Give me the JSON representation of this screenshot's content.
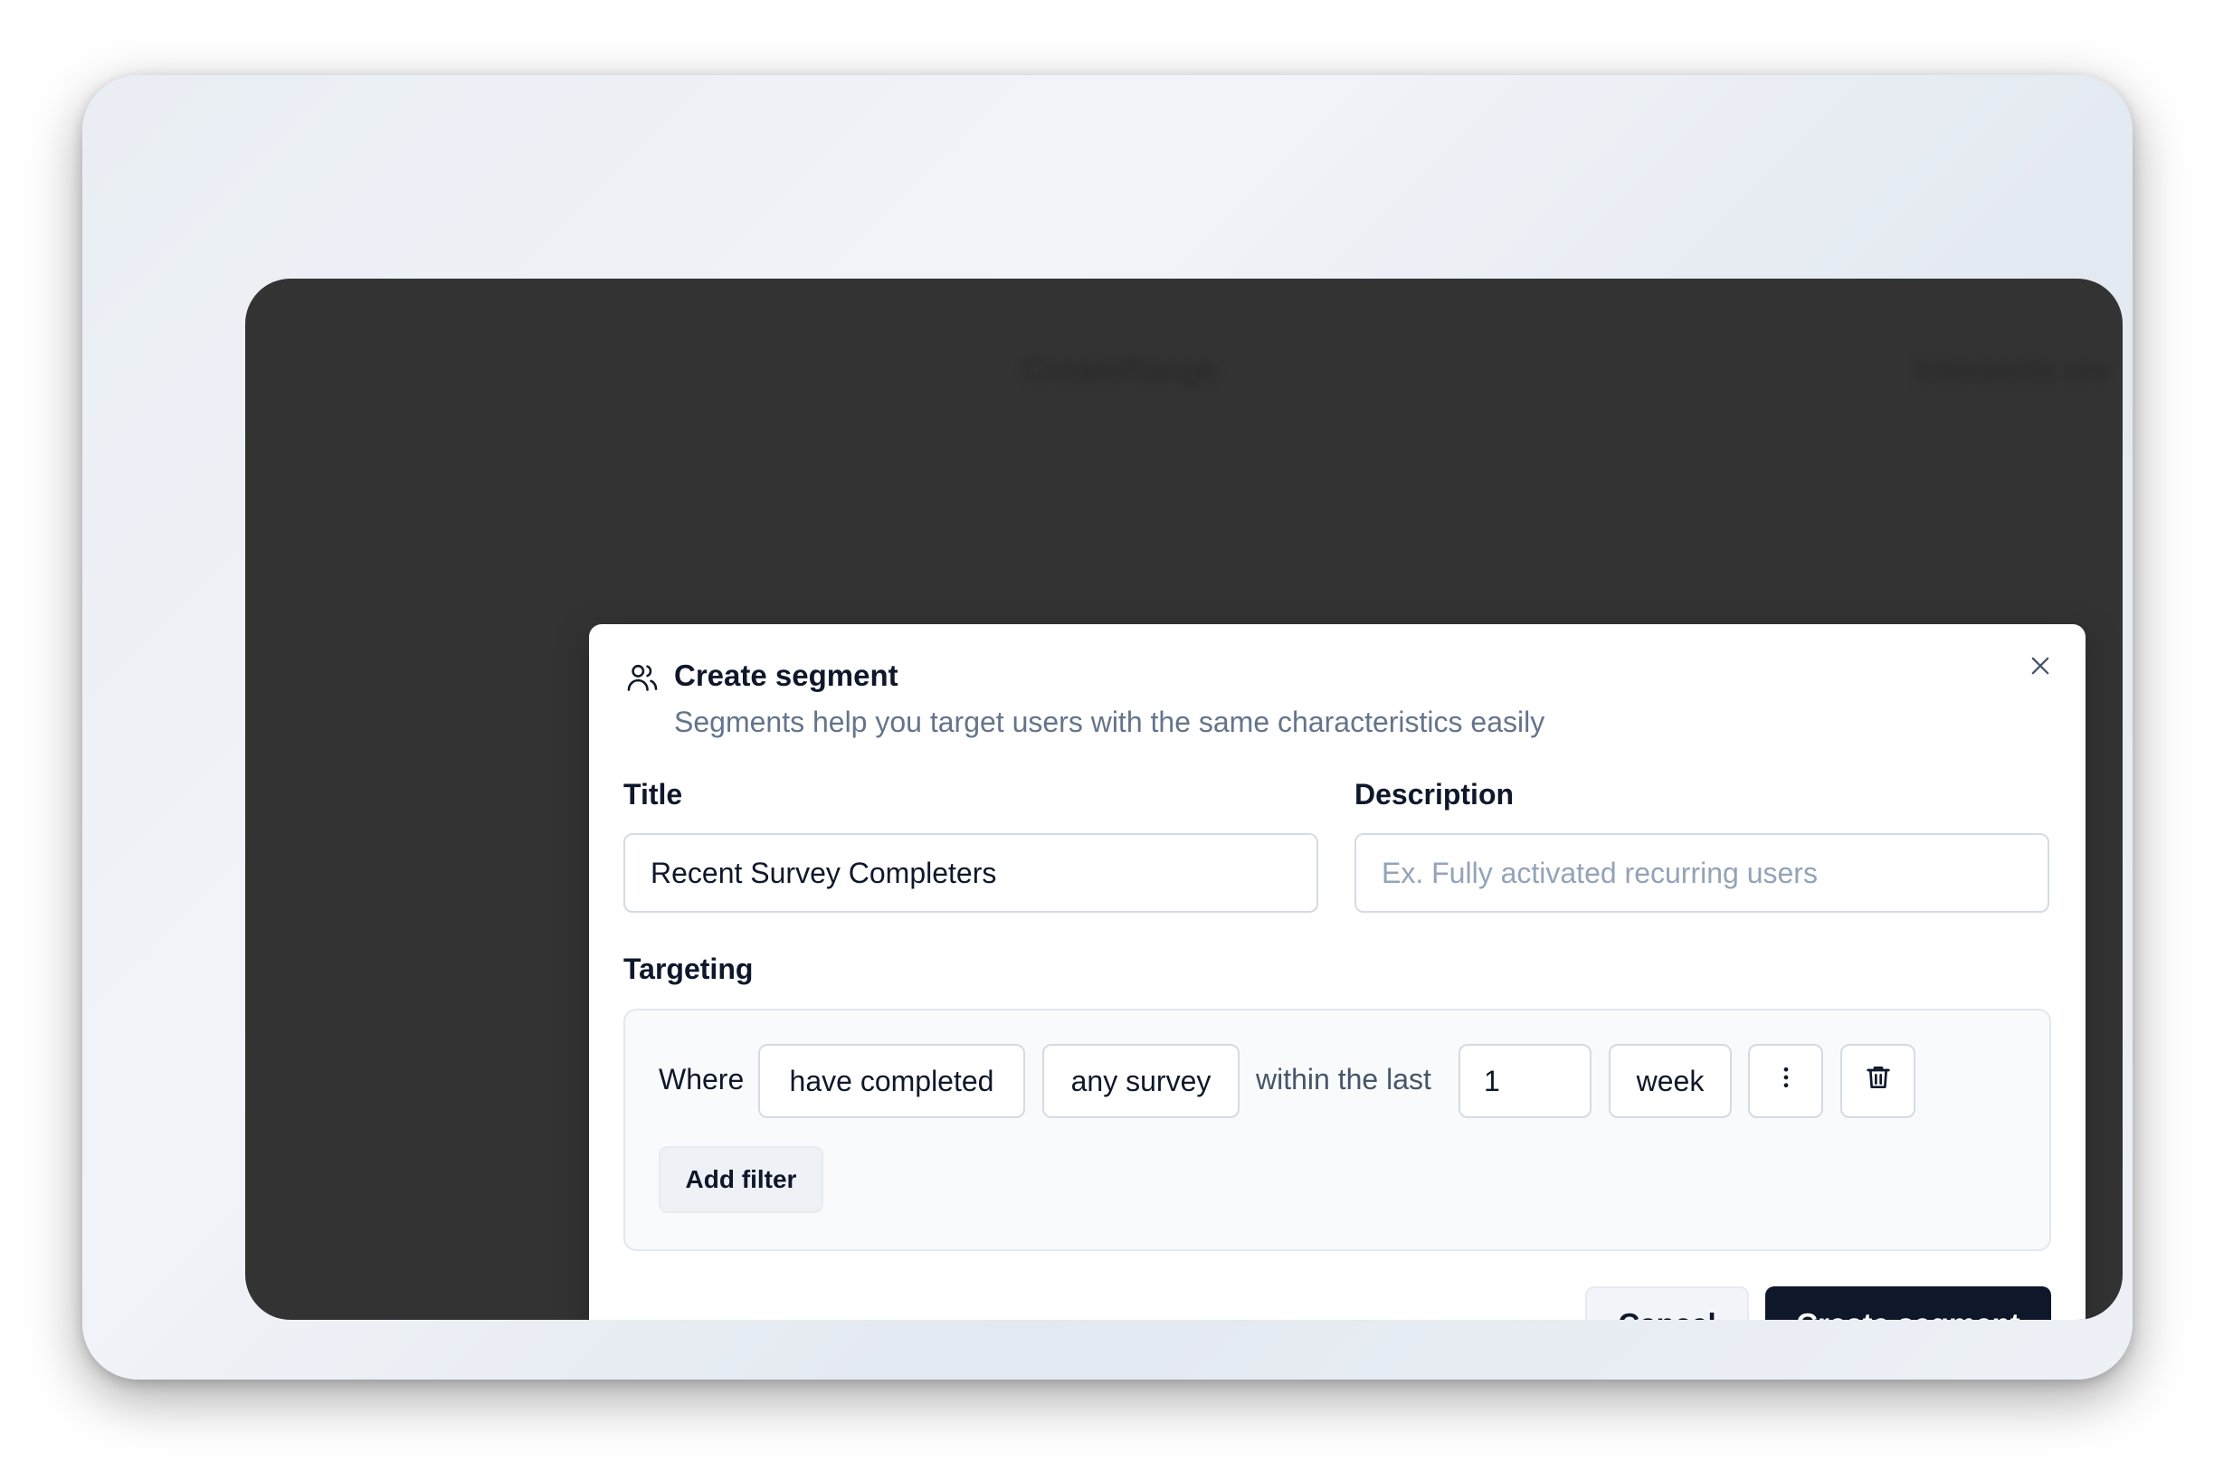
{
  "background_window": {
    "blurred_texts": [
      "CreateRange",
      "Intersects rev"
    ]
  },
  "modal": {
    "icon": "users-icon",
    "title": "Create segment",
    "subtitle": "Segments help you target users with the same characteristics easily",
    "close_icon": "close-icon",
    "title_field": {
      "label": "Title",
      "value": "Recent Survey Completers",
      "placeholder": ""
    },
    "description_field": {
      "label": "Description",
      "value": "",
      "placeholder": "Ex. Fully activated recurring users"
    },
    "targeting": {
      "label": "Targeting",
      "filter": {
        "where_label": "Where",
        "action": "have completed",
        "survey": "any survey",
        "connector": "within the last",
        "amount": "1",
        "unit": "week",
        "more_icon": "more-vertical-icon",
        "delete_icon": "trash-icon"
      },
      "add_filter_label": "Add filter"
    },
    "actions": {
      "cancel_label": "Cancel",
      "create_label": "Create segment"
    }
  },
  "colors": {
    "primary_button": "#0f172a",
    "overlay": "#333333",
    "muted_text": "#64748b",
    "border": "#d5dbe4"
  }
}
